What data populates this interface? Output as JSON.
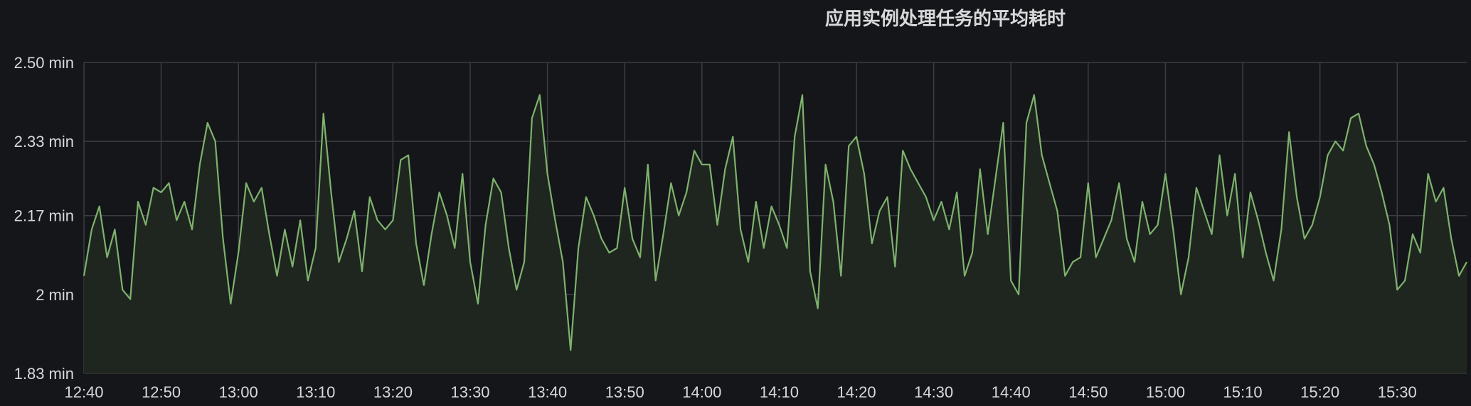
{
  "panel": {
    "title": "应用实例处理任务的平均耗时"
  },
  "colors": {
    "background": "#141619",
    "grid": "#3a3d42",
    "series": "#7eb26d",
    "fill": "#1f261f",
    "text": "#d8d9da"
  },
  "chart_data": {
    "type": "line",
    "title": "应用实例处理任务的平均耗时",
    "xlabel": "",
    "ylabel": "",
    "unit": "min",
    "ylim": [
      1.83,
      2.5
    ],
    "xlim": [
      "12:40",
      "15:39"
    ],
    "grid": true,
    "y_ticks": [
      {
        "v": 1.83,
        "label": "1.83 min"
      },
      {
        "v": 2.0,
        "label": "2 min"
      },
      {
        "v": 2.17,
        "label": "2.17 min"
      },
      {
        "v": 2.33,
        "label": "2.33 min"
      },
      {
        "v": 2.5,
        "label": "2.50 min"
      }
    ],
    "x_ticks": [
      "12:40",
      "12:50",
      "13:00",
      "13:10",
      "13:20",
      "13:30",
      "13:40",
      "13:50",
      "14:00",
      "14:10",
      "14:20",
      "14:30",
      "14:40",
      "14:50",
      "15:00",
      "15:10",
      "15:20",
      "15:30"
    ],
    "series": [
      {
        "points": [
          [
            "12:40",
            2.04
          ],
          [
            "12:41",
            2.14
          ],
          [
            "12:42",
            2.19
          ],
          [
            "12:43",
            2.08
          ],
          [
            "12:44",
            2.14
          ],
          [
            "12:45",
            2.01
          ],
          [
            "12:46",
            1.99
          ],
          [
            "12:47",
            2.2
          ],
          [
            "12:48",
            2.15
          ],
          [
            "12:49",
            2.23
          ],
          [
            "12:50",
            2.22
          ],
          [
            "12:51",
            2.24
          ],
          [
            "12:52",
            2.16
          ],
          [
            "12:53",
            2.2
          ],
          [
            "12:54",
            2.14
          ],
          [
            "12:55",
            2.28
          ],
          [
            "12:56",
            2.37
          ],
          [
            "12:57",
            2.33
          ],
          [
            "12:58",
            2.12
          ],
          [
            "12:59",
            1.98
          ],
          [
            "13:00",
            2.09
          ],
          [
            "13:01",
            2.24
          ],
          [
            "13:02",
            2.2
          ],
          [
            "13:03",
            2.23
          ],
          [
            "13:04",
            2.13
          ],
          [
            "13:05",
            2.04
          ],
          [
            "13:06",
            2.14
          ],
          [
            "13:07",
            2.06
          ],
          [
            "13:08",
            2.16
          ],
          [
            "13:09",
            2.03
          ],
          [
            "13:10",
            2.1
          ],
          [
            "13:11",
            2.39
          ],
          [
            "13:12",
            2.22
          ],
          [
            "13:13",
            2.07
          ],
          [
            "13:14",
            2.12
          ],
          [
            "13:15",
            2.18
          ],
          [
            "13:16",
            2.05
          ],
          [
            "13:17",
            2.21
          ],
          [
            "13:18",
            2.16
          ],
          [
            "13:19",
            2.14
          ],
          [
            "13:20",
            2.16
          ],
          [
            "13:21",
            2.29
          ],
          [
            "13:22",
            2.3
          ],
          [
            "13:23",
            2.11
          ],
          [
            "13:24",
            2.02
          ],
          [
            "13:25",
            2.13
          ],
          [
            "13:26",
            2.22
          ],
          [
            "13:27",
            2.17
          ],
          [
            "13:28",
            2.1
          ],
          [
            "13:29",
            2.26
          ],
          [
            "13:30",
            2.07
          ],
          [
            "13:31",
            1.98
          ],
          [
            "13:32",
            2.15
          ],
          [
            "13:33",
            2.25
          ],
          [
            "13:34",
            2.22
          ],
          [
            "13:35",
            2.1
          ],
          [
            "13:36",
            2.01
          ],
          [
            "13:37",
            2.07
          ],
          [
            "13:38",
            2.38
          ],
          [
            "13:39",
            2.43
          ],
          [
            "13:40",
            2.26
          ],
          [
            "13:41",
            2.16
          ],
          [
            "13:42",
            2.07
          ],
          [
            "13:43",
            1.88
          ],
          [
            "13:44",
            2.1
          ],
          [
            "13:45",
            2.21
          ],
          [
            "13:46",
            2.17
          ],
          [
            "13:47",
            2.12
          ],
          [
            "13:48",
            2.09
          ],
          [
            "13:49",
            2.1
          ],
          [
            "13:50",
            2.23
          ],
          [
            "13:51",
            2.12
          ],
          [
            "13:52",
            2.08
          ],
          [
            "13:53",
            2.28
          ],
          [
            "13:54",
            2.03
          ],
          [
            "13:55",
            2.13
          ],
          [
            "13:56",
            2.24
          ],
          [
            "13:57",
            2.17
          ],
          [
            "13:58",
            2.22
          ],
          [
            "13:59",
            2.31
          ],
          [
            "14:00",
            2.28
          ],
          [
            "14:01",
            2.28
          ],
          [
            "14:02",
            2.15
          ],
          [
            "14:03",
            2.27
          ],
          [
            "14:04",
            2.34
          ],
          [
            "14:05",
            2.14
          ],
          [
            "14:06",
            2.07
          ],
          [
            "14:07",
            2.2
          ],
          [
            "14:08",
            2.1
          ],
          [
            "14:09",
            2.19
          ],
          [
            "14:10",
            2.15
          ],
          [
            "14:11",
            2.1
          ],
          [
            "14:12",
            2.34
          ],
          [
            "14:13",
            2.43
          ],
          [
            "14:14",
            2.05
          ],
          [
            "14:15",
            1.97
          ],
          [
            "14:16",
            2.28
          ],
          [
            "14:17",
            2.2
          ],
          [
            "14:18",
            2.04
          ],
          [
            "14:19",
            2.32
          ],
          [
            "14:20",
            2.34
          ],
          [
            "14:21",
            2.26
          ],
          [
            "14:22",
            2.11
          ],
          [
            "14:23",
            2.18
          ],
          [
            "14:24",
            2.21
          ],
          [
            "14:25",
            2.06
          ],
          [
            "14:26",
            2.31
          ],
          [
            "14:27",
            2.27
          ],
          [
            "14:28",
            2.24
          ],
          [
            "14:29",
            2.21
          ],
          [
            "14:30",
            2.16
          ],
          [
            "14:31",
            2.2
          ],
          [
            "14:32",
            2.14
          ],
          [
            "14:33",
            2.22
          ],
          [
            "14:34",
            2.04
          ],
          [
            "14:35",
            2.09
          ],
          [
            "14:36",
            2.27
          ],
          [
            "14:37",
            2.13
          ],
          [
            "14:38",
            2.25
          ],
          [
            "14:39",
            2.37
          ],
          [
            "14:40",
            2.03
          ],
          [
            "14:41",
            2.0
          ],
          [
            "14:42",
            2.37
          ],
          [
            "14:43",
            2.43
          ],
          [
            "14:44",
            2.3
          ],
          [
            "14:45",
            2.24
          ],
          [
            "14:46",
            2.18
          ],
          [
            "14:47",
            2.04
          ],
          [
            "14:48",
            2.07
          ],
          [
            "14:49",
            2.08
          ],
          [
            "14:50",
            2.24
          ],
          [
            "14:51",
            2.08
          ],
          [
            "14:52",
            2.12
          ],
          [
            "14:53",
            2.16
          ],
          [
            "14:54",
            2.24
          ],
          [
            "14:55",
            2.12
          ],
          [
            "14:56",
            2.07
          ],
          [
            "14:57",
            2.2
          ],
          [
            "14:58",
            2.13
          ],
          [
            "14:59",
            2.15
          ],
          [
            "15:00",
            2.26
          ],
          [
            "15:01",
            2.14
          ],
          [
            "15:02",
            2.0
          ],
          [
            "15:03",
            2.08
          ],
          [
            "15:04",
            2.23
          ],
          [
            "15:05",
            2.18
          ],
          [
            "15:06",
            2.13
          ],
          [
            "15:07",
            2.3
          ],
          [
            "15:08",
            2.17
          ],
          [
            "15:09",
            2.26
          ],
          [
            "15:10",
            2.08
          ],
          [
            "15:11",
            2.22
          ],
          [
            "15:12",
            2.16
          ],
          [
            "15:13",
            2.09
          ],
          [
            "15:14",
            2.03
          ],
          [
            "15:15",
            2.14
          ],
          [
            "15:16",
            2.35
          ],
          [
            "15:17",
            2.21
          ],
          [
            "15:18",
            2.12
          ],
          [
            "15:19",
            2.15
          ],
          [
            "15:20",
            2.21
          ],
          [
            "15:21",
            2.3
          ],
          [
            "15:22",
            2.33
          ],
          [
            "15:23",
            2.31
          ],
          [
            "15:24",
            2.38
          ],
          [
            "15:25",
            2.39
          ],
          [
            "15:26",
            2.32
          ],
          [
            "15:27",
            2.28
          ],
          [
            "15:28",
            2.22
          ],
          [
            "15:29",
            2.15
          ],
          [
            "15:30",
            2.01
          ],
          [
            "15:31",
            2.03
          ],
          [
            "15:32",
            2.13
          ],
          [
            "15:33",
            2.09
          ],
          [
            "15:34",
            2.26
          ],
          [
            "15:35",
            2.2
          ],
          [
            "15:36",
            2.23
          ],
          [
            "15:37",
            2.12
          ],
          [
            "15:38",
            2.04
          ],
          [
            "15:39",
            2.07
          ]
        ]
      }
    ]
  }
}
